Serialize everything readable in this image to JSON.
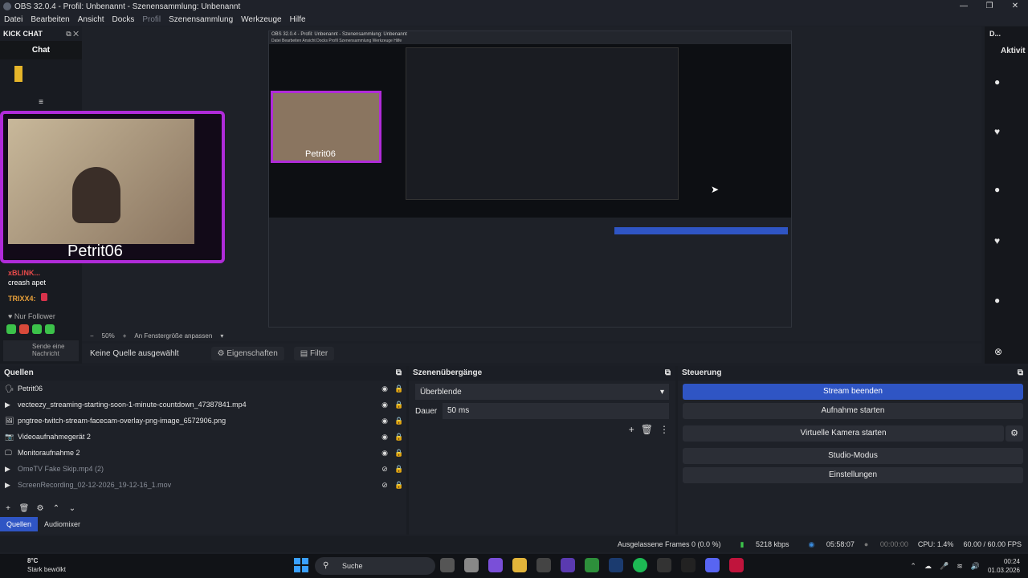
{
  "window": {
    "title": "OBS 32.0.4 - Profil: Unbenannt - Szenensammlung: Unbenannt",
    "controls": [
      "—",
      "❐",
      "✕"
    ]
  },
  "menu": [
    "Datei",
    "Bearbeiten",
    "Ansicht",
    "Docks",
    "Profil",
    "Szenensammlung",
    "Werkzeuge",
    "Hilfe"
  ],
  "left_dock": {
    "title": "KICK CHAT",
    "chat_title": "Chat",
    "messages": [
      {
        "user": "xBLINK...",
        "text": "creash apet"
      },
      {
        "user": "TRIXX4:",
        "text": ""
      }
    ],
    "follower_label": "Nur Follower",
    "input_placeholder": "Sende eine Nachricht"
  },
  "preview": {
    "webcam_name": "Petrit06",
    "nested_title": "OBS 32.0.4 - Profil: Unbenannt - Szenensammlung: Unbenannt"
  },
  "right_dock": {
    "title_short": "D...",
    "activity_label": "Aktivit"
  },
  "zoombar": {
    "minus": "−",
    "zoom": "50%",
    "plus": "+",
    "fit": "An Fenstergröße anpassen"
  },
  "source_toolbar": {
    "no_source": "Keine Quelle ausgewählt",
    "properties": "Eigenschaften",
    "filter": "Filter"
  },
  "sources": {
    "title": "Quellen",
    "items": [
      {
        "name": "Petrit06",
        "icon": "🗣",
        "dim": false
      },
      {
        "name": "vecteezy_streaming-starting-soon-1-minute-countdown_47387841.mp4",
        "icon": "▶",
        "dim": false
      },
      {
        "name": "pngtree-twitch-stream-facecam-overlay-png-image_6572906.png",
        "icon": "🖼",
        "dim": false
      },
      {
        "name": "Videoaufnahmegerät 2",
        "icon": "📷",
        "dim": false
      },
      {
        "name": "Monitoraufnahme 2",
        "icon": "🖵",
        "dim": false
      },
      {
        "name": "OmeTV Fake Skip.mp4 (2)",
        "icon": "▶",
        "dim": true
      },
      {
        "name": "ScreenRecording_02-12-2026_19-12-16_1.mov",
        "icon": "▶",
        "dim": true
      }
    ],
    "tabs": [
      "Quellen",
      "Audiomixer"
    ]
  },
  "transitions": {
    "title": "Szenenübergänge",
    "selected": "Überblende",
    "duration_label": "Dauer",
    "duration_value": "50 ms"
  },
  "controls": {
    "title": "Steuerung",
    "buttons": [
      "Stream beenden",
      "Aufnahme starten",
      "Virtuelle Kamera starten",
      "Studio-Modus",
      "Einstellungen"
    ]
  },
  "status": {
    "dropped": "Ausgelassene Frames 0 (0.0 %)",
    "bitrate": "5218 kbps",
    "stream_time": "05:58:07",
    "rec_time": "00:00:00",
    "cpu": "CPU: 1.4%",
    "fps": "60.00 / 60.00 FPS"
  },
  "taskbar": {
    "temp": "8°C",
    "weather": "Stark bewölkt",
    "search": "Suche",
    "time": "00:24",
    "date": "01.03.2026"
  },
  "colors": {
    "accent": "#2f55c4",
    "neon_frame": "#b02bd9",
    "bg": "#1e2128"
  }
}
